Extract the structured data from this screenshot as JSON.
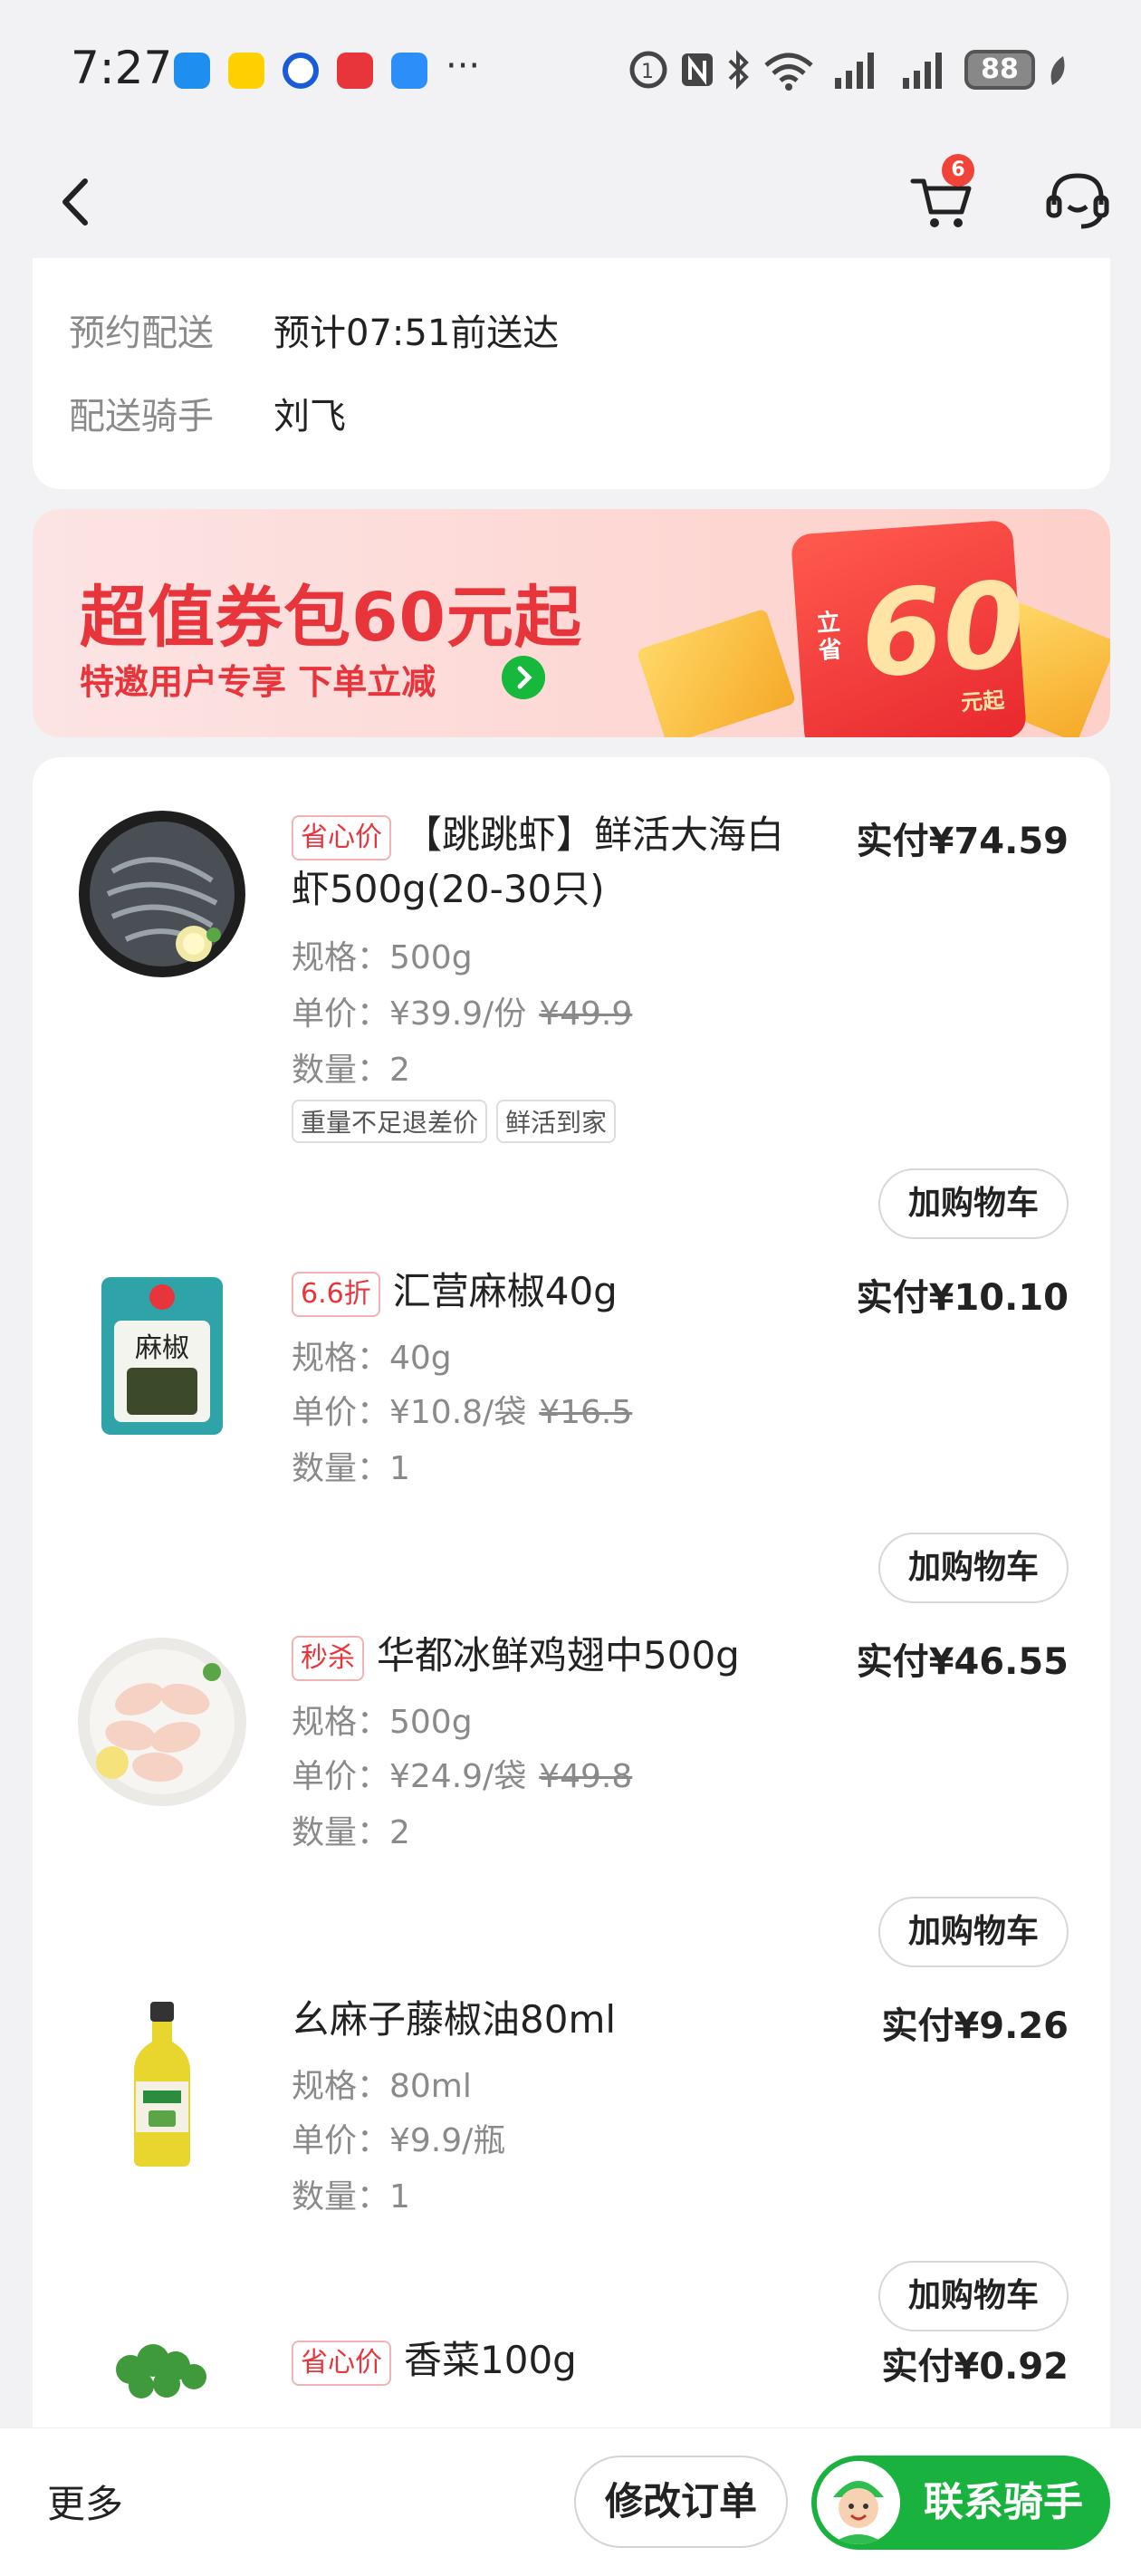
{
  "status_bar": {
    "time": "7:27",
    "battery": "88",
    "overflow": "···"
  },
  "nav": {
    "cart_badge": "6"
  },
  "delivery": {
    "schedule_label": "预约配送",
    "schedule_value": "预计07:51前送达",
    "rider_label": "配送骑手",
    "rider_value": "刘飞"
  },
  "banner": {
    "title": "超值券包60元起",
    "subtitle": "特邀用户专享 下单立减",
    "coupon_prefix": "立省",
    "coupon_amount": "60",
    "coupon_suffix": "元起"
  },
  "items": [
    {
      "tag": "省心价",
      "name": "【跳跳虾】鲜活大海白虾500g(20-30只)",
      "paid": "实付¥74.59",
      "spec": "规格：500g",
      "unit_price": "单价：¥39.9/份",
      "original_price": "¥49.9",
      "quantity": "数量：2",
      "chips": [
        "重量不足退差价",
        "鲜活到家"
      ],
      "add_cart": "加购物车"
    },
    {
      "tag": "6.6折",
      "name": "汇营麻椒40g",
      "paid": "实付¥10.10",
      "spec": "规格：40g",
      "unit_price": "单价：¥10.8/袋",
      "original_price": "¥16.5",
      "quantity": "数量：1",
      "package_text": "麻椒",
      "add_cart": "加购物车"
    },
    {
      "tag": "秒杀",
      "name": "华都冰鲜鸡翅中500g",
      "paid": "实付¥46.55",
      "spec": "规格：500g",
      "unit_price": "单价：¥24.9/袋",
      "original_price": "¥49.8",
      "quantity": "数量：2",
      "add_cart": "加购物车"
    },
    {
      "name": "幺麻子藤椒油80ml",
      "paid": "实付¥9.26",
      "spec": "规格：80ml",
      "unit_price": "单价：¥9.9/瓶",
      "quantity": "数量：1",
      "add_cart": "加购物车"
    },
    {
      "tag": "省心价",
      "name": "香菜100g",
      "paid": "实付¥0.92"
    }
  ],
  "bottom": {
    "more": "更多",
    "modify_order": "修改订单",
    "contact_rider": "联系骑手"
  },
  "colors": {
    "accent_red": "#e8343b",
    "accent_green": "#19b23f",
    "background": "#f2f2f4"
  },
  "icons": [
    "back-icon",
    "cart-icon",
    "customer-service-icon",
    "wifi-icon",
    "bluetooth-icon",
    "nfc-icon",
    "signal-icon",
    "battery-icon"
  ]
}
